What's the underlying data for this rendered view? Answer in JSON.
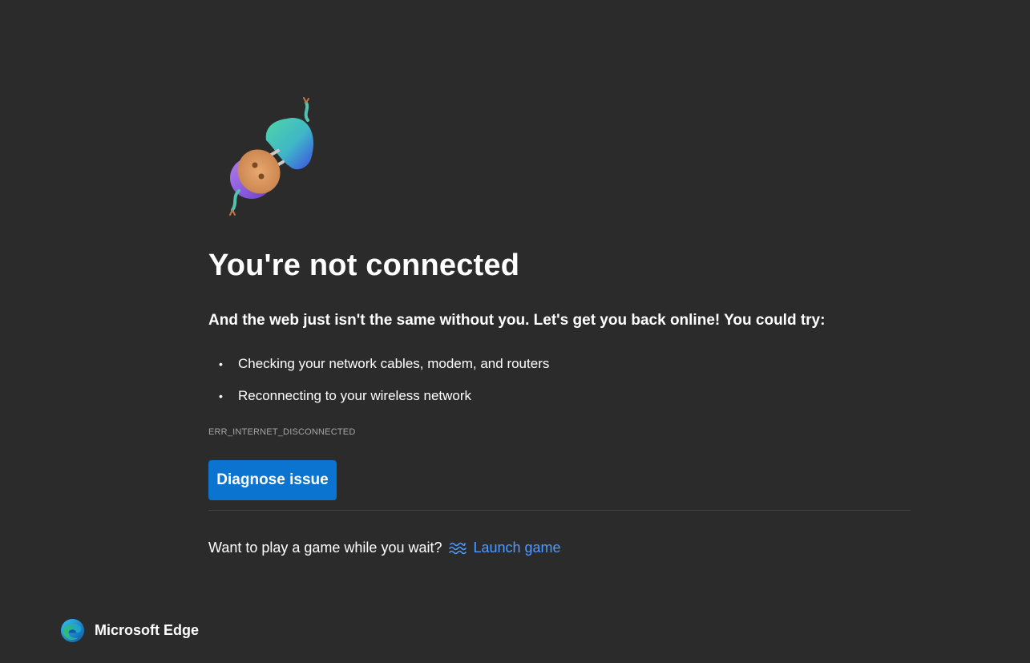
{
  "illustration": {
    "icon": "unplugged-plug-icon"
  },
  "main": {
    "title": "You're not connected",
    "subtitle": "And the web just isn't the same without you. Let's get you back online! You could try:",
    "suggestions": [
      "Checking your network cables, modem, and routers",
      "Reconnecting to your wireless network"
    ],
    "error_code": "ERR_INTERNET_DISCONNECTED",
    "diagnose_label": "Diagnose issue",
    "game_prompt": "Want to play a game while you wait?",
    "game_icon": "surf-wave-icon",
    "launch_game_label": "Launch game"
  },
  "footer": {
    "brand_icon": "microsoft-edge-logo-icon",
    "brand_name": "Microsoft Edge"
  },
  "colors": {
    "background": "#2b2b2b",
    "primary_button": "#0a74d0",
    "link": "#4f9bff",
    "error_code_text": "#a6a6a6"
  }
}
